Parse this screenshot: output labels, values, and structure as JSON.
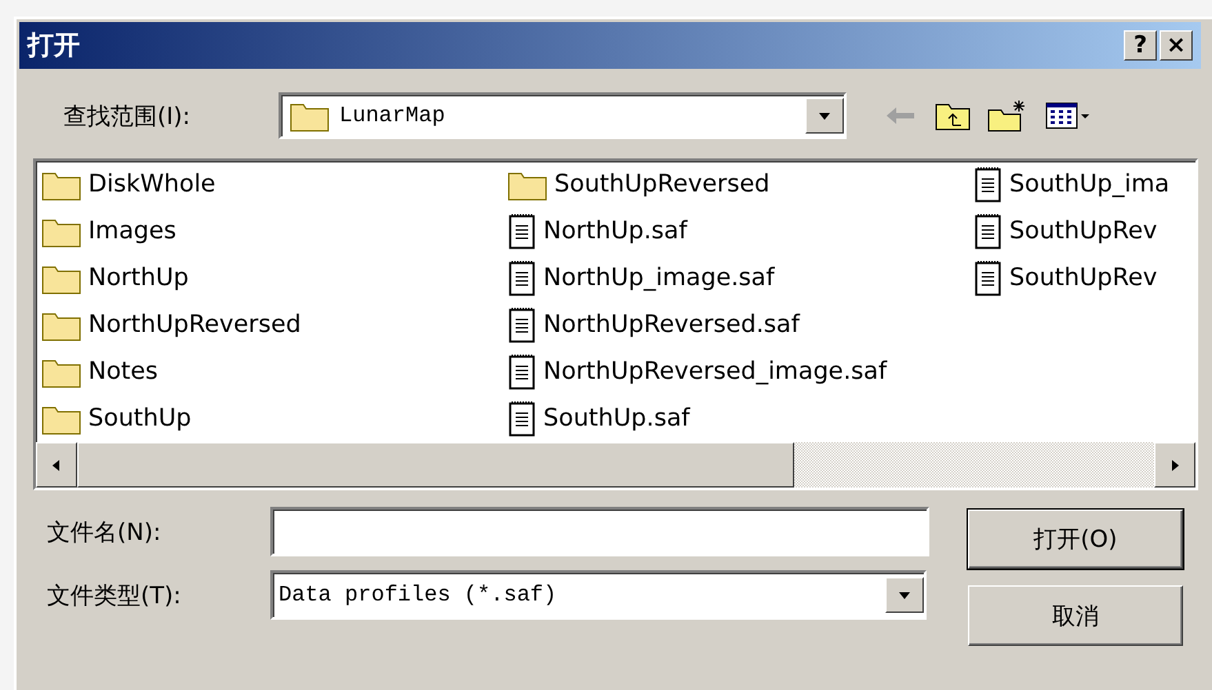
{
  "window": {
    "title": "打开",
    "help_button": "?",
    "close_button": "×"
  },
  "look_in": {
    "label": "查找范围(I):",
    "value": "LunarMap"
  },
  "files": [
    {
      "name": "DiskWhole",
      "kind": "folder"
    },
    {
      "name": "Images",
      "kind": "folder"
    },
    {
      "name": "NorthUp",
      "kind": "folder"
    },
    {
      "name": "NorthUpReversed",
      "kind": "folder"
    },
    {
      "name": "Notes",
      "kind": "folder"
    },
    {
      "name": "SouthUp",
      "kind": "folder"
    },
    {
      "name": "SouthUpReversed",
      "kind": "folder"
    },
    {
      "name": "NorthUp.saf",
      "kind": "file"
    },
    {
      "name": "NorthUp_image.saf",
      "kind": "file"
    },
    {
      "name": "NorthUpReversed.saf",
      "kind": "file"
    },
    {
      "name": "NorthUpReversed_image.saf",
      "kind": "file"
    },
    {
      "name": "SouthUp.saf",
      "kind": "file"
    },
    {
      "name": "SouthUp_ima",
      "kind": "file"
    },
    {
      "name": "SouthUpRev",
      "kind": "file"
    },
    {
      "name": "SouthUpRev",
      "kind": "file"
    }
  ],
  "file_name": {
    "label": "文件名(N):"
  },
  "file_type": {
    "label": "文件类型(T):",
    "value": "Data profiles (*.saf)"
  },
  "buttons": [
    {
      "label": "打开(O)",
      "kind": "default"
    },
    {
      "label": "取消",
      "kind": "normal"
    }
  ]
}
